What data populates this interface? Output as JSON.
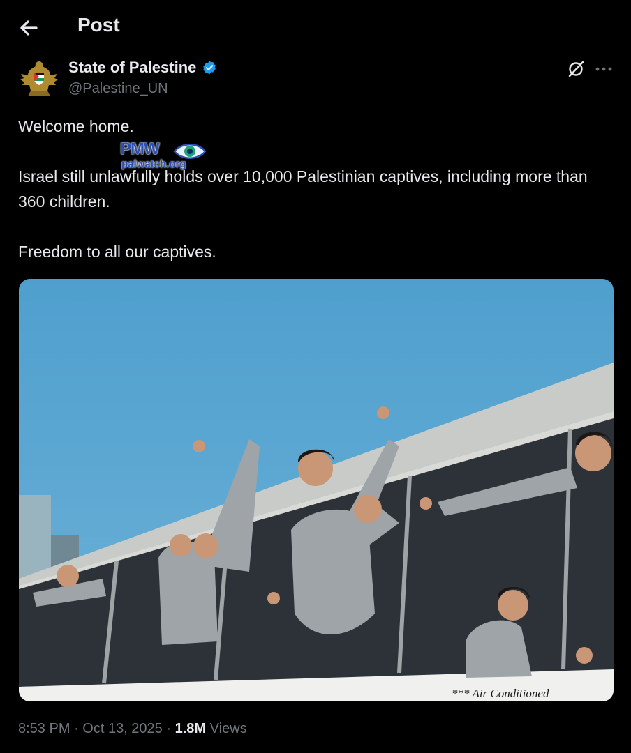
{
  "header": {
    "title": "Post"
  },
  "author": {
    "display_name": "State of Palestine",
    "handle": "@Palestine_UN"
  },
  "tweet": {
    "paragraphs": [
      "Welcome home.",
      "Israel still unlawfully holds over 10,000 Palestinian captives, including more than 360 children.",
      "Freedom to all our captives."
    ]
  },
  "watermark": {
    "brand": "PMW",
    "url": "palwatch.org"
  },
  "photo": {
    "bus_lettering": "*** Air Conditioned"
  },
  "meta": {
    "time": "8:53 PM",
    "separator": "·",
    "date": "Oct 13, 2025",
    "views_count": "1.8M",
    "views_label": "Views"
  },
  "colors": {
    "background": "#000000",
    "text": "#e7e9ea",
    "muted": "#71767b",
    "verified": "#1d9bf0",
    "sky": "#5ba6d3"
  },
  "icons": {
    "back": "arrow-left-icon",
    "verified": "verified-badge-icon",
    "grok": "grok-icon",
    "more": "more-dots-icon"
  }
}
